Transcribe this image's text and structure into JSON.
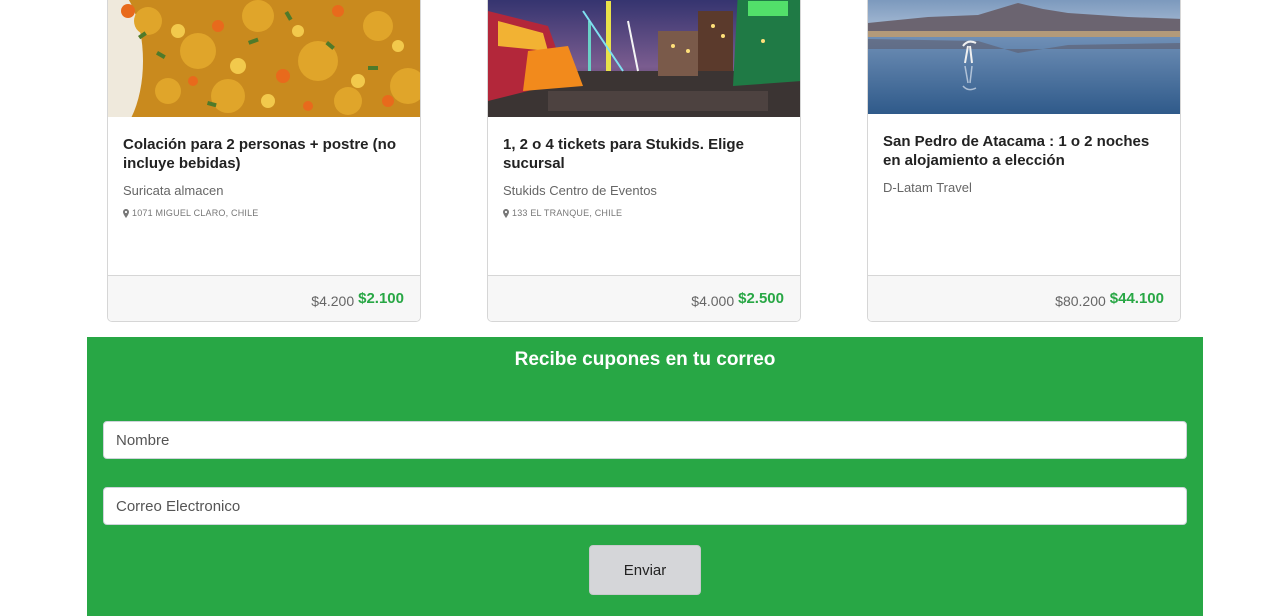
{
  "cards": [
    {
      "title": "Colación para 2 personas + postre (no incluye bebidas)",
      "merchant": "Suricata almacen",
      "address": "1071 MIGUEL CLARO, CHILE",
      "old_price": "$4.200",
      "new_price": "$2.100"
    },
    {
      "title": "1, 2 o 4 tickets para Stukids. Elige sucursal",
      "merchant": "Stukids Centro de Eventos",
      "address": "133 EL TRANQUE, CHILE",
      "old_price": "$4.000",
      "new_price": "$2.500"
    },
    {
      "title": "San Pedro de Atacama : 1 o 2 noches en alojamiento a elección",
      "merchant": "D-Latam Travel",
      "address": "",
      "old_price": "$80.200",
      "new_price": "$44.100"
    }
  ],
  "newsletter": {
    "title": "Recibe cupones en tu correo",
    "name_placeholder": "Nombre",
    "email_placeholder": "Correo Electronico",
    "submit_label": "Enviar"
  },
  "colors": {
    "accent_green": "#28a745",
    "button_gray": "#d5d6d9"
  },
  "icons": {
    "address": "map-marker-icon"
  }
}
